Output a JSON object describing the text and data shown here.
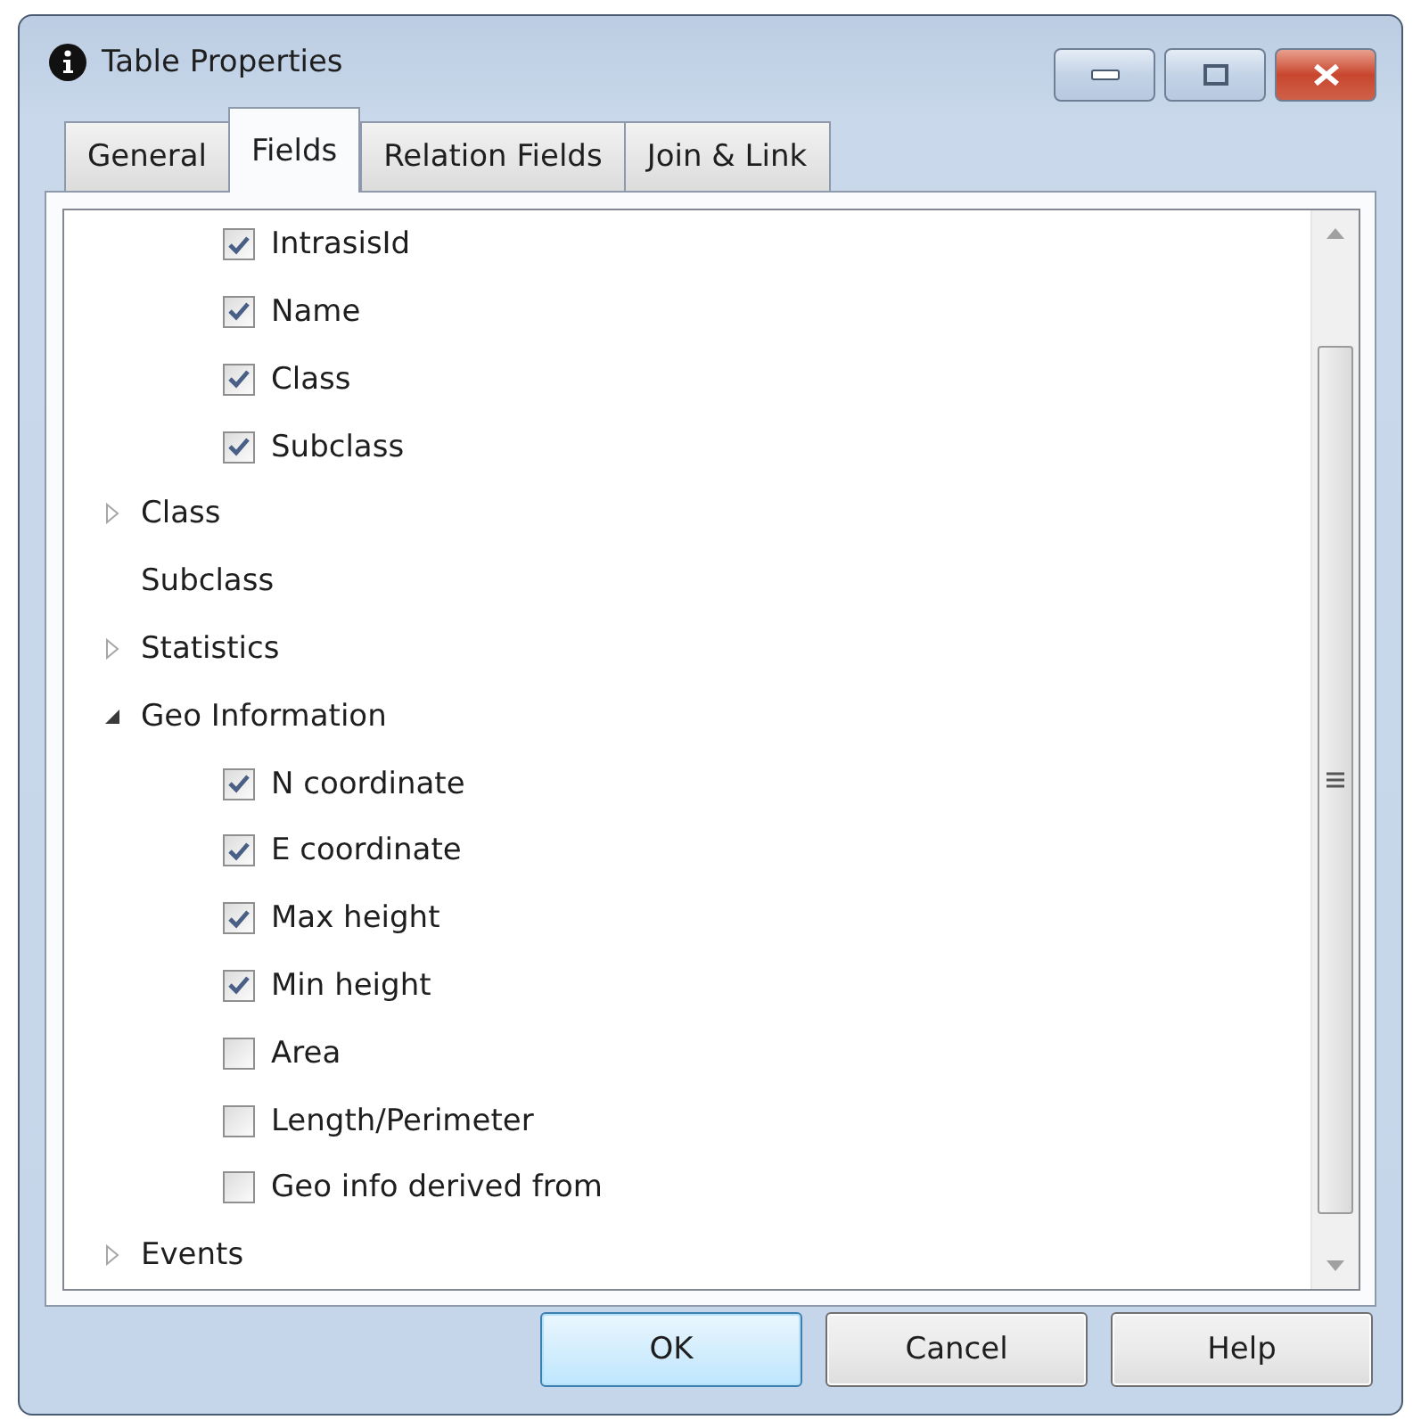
{
  "window": {
    "title": "Table Properties"
  },
  "tabs": [
    {
      "label": "General",
      "selected": false
    },
    {
      "label": "Fields",
      "selected": true
    },
    {
      "label": "Relation Fields",
      "selected": false
    },
    {
      "label": "Join & Link",
      "selected": false
    }
  ],
  "tree": [
    {
      "kind": "hidden-parent",
      "children": [
        {
          "label": "IntrasisId",
          "checked": true
        },
        {
          "label": "Name",
          "checked": true
        },
        {
          "label": "Class",
          "checked": true
        },
        {
          "label": "Subclass",
          "checked": true
        }
      ]
    },
    {
      "kind": "group",
      "label": "Class",
      "expanded": false
    },
    {
      "kind": "leaf",
      "label": "Subclass"
    },
    {
      "kind": "group",
      "label": "Statistics",
      "expanded": false
    },
    {
      "kind": "group",
      "label": "Geo Information",
      "expanded": true,
      "children": [
        {
          "label": "N coordinate",
          "checked": true
        },
        {
          "label": "E coordinate",
          "checked": true
        },
        {
          "label": "Max height",
          "checked": true
        },
        {
          "label": "Min height",
          "checked": true
        },
        {
          "label": "Area",
          "checked": false
        },
        {
          "label": "Length/Perimeter",
          "checked": false
        },
        {
          "label": "Geo info derived from",
          "checked": false
        }
      ]
    },
    {
      "kind": "group",
      "label": "Events",
      "expanded": false
    }
  ],
  "buttons": [
    {
      "label": "OK",
      "default": true
    },
    {
      "label": "Cancel",
      "default": false
    },
    {
      "label": "Help",
      "default": false
    }
  ]
}
